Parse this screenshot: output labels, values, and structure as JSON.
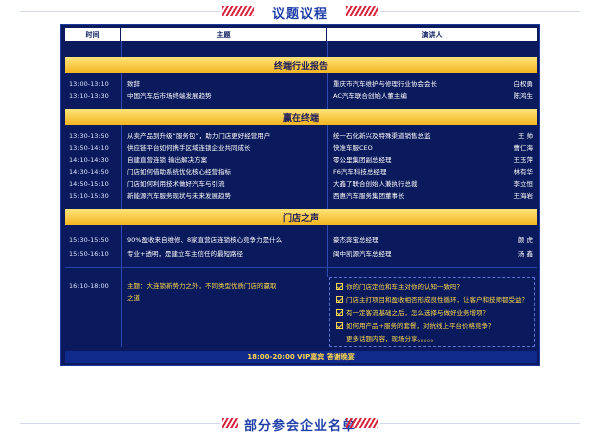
{
  "section1": {
    "title": "议题议程"
  },
  "section2": {
    "title": "部分参会企业名单"
  },
  "table": {
    "headers": [
      "时间",
      "主题",
      "演讲人"
    ]
  },
  "blocks": [
    {
      "title": "终端行业报告",
      "rows": [
        {
          "time": "13:00-13:10",
          "topic": "致辞",
          "org": "重庆市汽车维护与修理行业协会会长",
          "name": "白权勇"
        },
        {
          "time": "13:10-13:30",
          "topic": "中国汽车后市场终端发展趋势",
          "org": "AC汽车联合创始人董主编",
          "name": "陈鸿生"
        }
      ]
    },
    {
      "title": "赢在终端",
      "rows": [
        {
          "time": "13:30-13:50",
          "topic": "从卖产品到升级“服务包”，助力门店更好经营用户",
          "org": "统一石化新兴及特殊渠道销售总监",
          "name": "王  帅"
        },
        {
          "time": "13:50-14:10",
          "topic": "供应链平台如何携手区域连锁企业共同成长",
          "org": "快准车服CEO",
          "name": "曹仁海"
        },
        {
          "time": "14:10-14:30",
          "topic": "自建直营连锁 输出解决方案",
          "org": "零公里集团副总经理",
          "name": "王玉萍"
        },
        {
          "time": "14:30-14:50",
          "topic": "门店如何借助系统优化核心经营指标",
          "org": "F6汽车科技总经理",
          "name": "林有华"
        },
        {
          "time": "14:50-15:10",
          "topic": "门店如何利用技术做好汽车与引流",
          "org": "大鑫了联合创始人兼执行总裁",
          "name": "李立恒"
        },
        {
          "time": "15:10-15:30",
          "topic": "新能源汽车服务现状与未来发展趋势",
          "org": "西惠汽车服务集团董事长",
          "name": "王海岩"
        }
      ]
    },
    {
      "title": "门店之声",
      "rows": [
        {
          "time": "15:30-15:50",
          "topic": "90%盈收来自维修、8家直营店连锁核心竞争力是什么",
          "org": "豪杰奔宝总经理",
          "name": "颜  虎"
        },
        {
          "time": "15:50-16:10",
          "topic": "专业+透明，是建立车主信任的最短路径",
          "org": "闽中凯源汽车总经理",
          "name": "汤  鑫"
        }
      ]
    }
  ],
  "discussion": {
    "time": "16:10-18:00",
    "topic_line1": "主题：大连锁新势力之外，不同类型优质门店的赢取",
    "topic_line2": "之道",
    "questions": [
      "你的门店定位和车主对你的认知一致吗？",
      "门店主打项目和盈收相否形成良性循环，让客户和技师都受益？",
      "有一定客流基础之后，怎么选择与做好业务增项？",
      "如何用产品+服务的套餐，对抗线上平台价格竞争？",
      "更多话题内容，现场分享。。。。。"
    ]
  },
  "footer": {
    "text": "18:00-20:00 VIP嘉宾 答谢晚宴"
  }
}
